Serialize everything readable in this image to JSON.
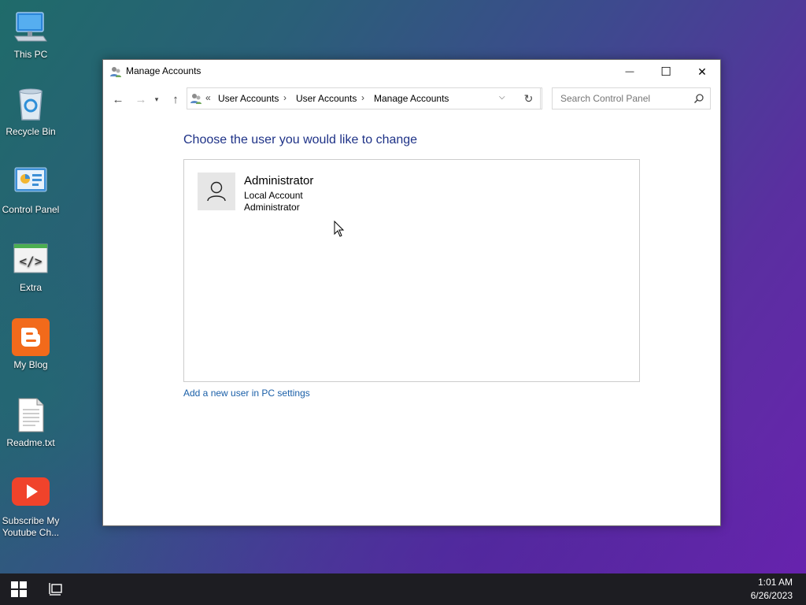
{
  "desktop": {
    "icons": [
      {
        "label": "This PC",
        "icon": "computer-icon"
      },
      {
        "label": "Recycle Bin",
        "icon": "recycle-bin-icon"
      },
      {
        "label": "Control Panel",
        "icon": "control-panel-icon"
      },
      {
        "label": "Extra",
        "icon": "code-window-icon"
      },
      {
        "label": "My Blog",
        "icon": "blogger-icon"
      },
      {
        "label": "Readme.txt",
        "icon": "text-file-icon"
      },
      {
        "label": "Subscribe My Youtube Ch...",
        "icon": "youtube-icon"
      }
    ]
  },
  "window": {
    "title": "Manage Accounts",
    "controls": {
      "minimize": "—",
      "maximize": "☐",
      "close": "✕"
    },
    "address": {
      "overflow": "«",
      "breadcrumbs": [
        "User Accounts",
        "User Accounts",
        "Manage Accounts"
      ]
    },
    "search": {
      "placeholder": "Search Control Panel"
    },
    "heading": "Choose the user you would like to change",
    "users": [
      {
        "name": "Administrator",
        "type": "Local Account",
        "role": "Administrator"
      }
    ],
    "add_user_link": "Add a new user in PC settings"
  },
  "taskbar": {
    "time": "1:01 AM",
    "date": "6/26/2023"
  },
  "colors": {
    "heading": "#1e3287",
    "link": "#1a5fa8",
    "taskbar": "#1d1d22"
  }
}
